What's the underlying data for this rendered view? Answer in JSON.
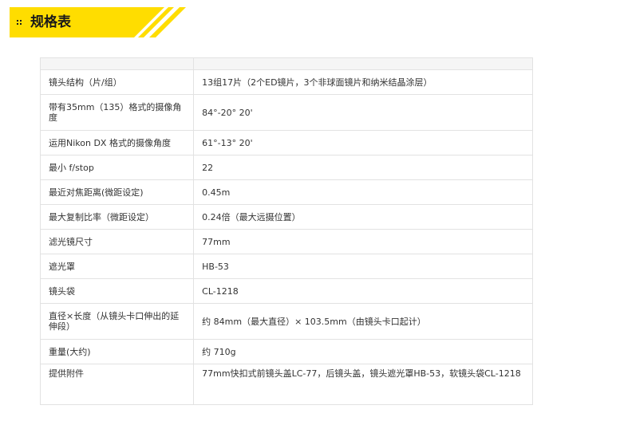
{
  "header": {
    "title": "规格表",
    "accent_color": "#ffdd00",
    "icon": "bullet-grid-icon"
  },
  "spec_table": {
    "rows": [
      {
        "label": "镜头结构（片/组）",
        "value": "13组17片（2个ED镜片，3个非球面镜片和纳米结晶涂层）"
      },
      {
        "label": "带有35mm（135）格式的摄像角度",
        "value": "84°-20° 20'"
      },
      {
        "label": "运用Nikon DX 格式的摄像角度",
        "value": "61°-13° 20'"
      },
      {
        "label": "最小 f/stop",
        "value": "22"
      },
      {
        "label": "最近对焦距离(微距设定)",
        "value": "0.45m"
      },
      {
        "label": "最大复制比率（微距设定）",
        "value": "0.24倍（最大远摄位置）"
      },
      {
        "label": "滤光镜尺寸",
        "value": "77mm"
      },
      {
        "label": "遮光罩",
        "value": "HB-53"
      },
      {
        "label": "镜头袋",
        "value": "CL-1218"
      },
      {
        "label": "直径×长度（从镜头卡口伸出的延伸段）",
        "value": "约 84mm（最大直径）× 103.5mm（由镜头卡口起计）"
      },
      {
        "label": "重量(大约)",
        "value": "约 710g"
      },
      {
        "label": "提供附件",
        "value": "77mm快扣式前镜头盖LC-77，后镜头盖，镜头遮光罩HB-53，软镜头袋CL-1218"
      }
    ]
  }
}
